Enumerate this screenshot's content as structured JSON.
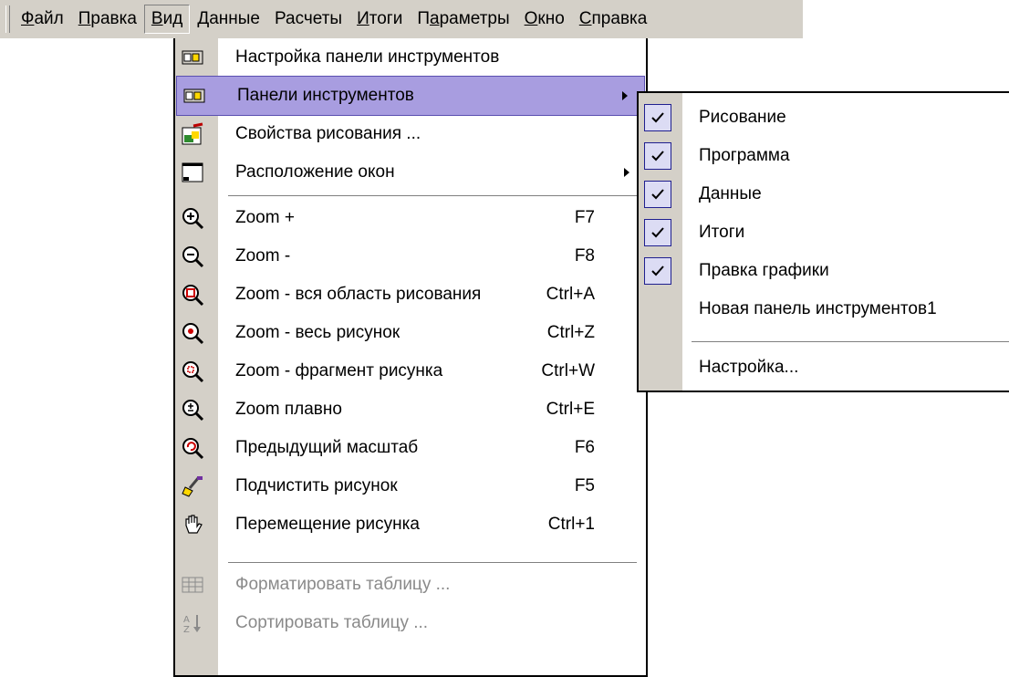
{
  "menubar": {
    "items": [
      {
        "label": "Файл",
        "accel": "Ф"
      },
      {
        "label": "Правка",
        "accel": "П"
      },
      {
        "label": "Вид",
        "accel": "В"
      },
      {
        "label": "Данные",
        "accel": "Д"
      },
      {
        "label": "Расчеты",
        "accel": ""
      },
      {
        "label": "Итоги",
        "accel": "И"
      },
      {
        "label": "Параметры",
        "accel": "а"
      },
      {
        "label": "Окно",
        "accel": "О"
      },
      {
        "label": "Справка",
        "accel": "С"
      }
    ],
    "open_item": "Вид"
  },
  "view_menu": {
    "items": [
      {
        "label": "Настройка панели инструментов",
        "shortcut": "",
        "icon": "toolbar-settings-icon"
      },
      {
        "label": "Панели инструментов",
        "shortcut": "",
        "icon": "toolbars-icon",
        "submenu": true,
        "highlighted": true
      },
      {
        "label": "Свойства рисования ...",
        "shortcut": "",
        "icon": "drawing-properties-icon"
      },
      {
        "label": "Расположение окон",
        "shortcut": "",
        "icon": "window-layout-icon",
        "submenu": true
      },
      {
        "label": "Zoom +",
        "shortcut": "F7",
        "icon": "zoom-in-icon"
      },
      {
        "label": "Zoom -",
        "shortcut": "F8",
        "icon": "zoom-out-icon"
      },
      {
        "label": "Zoom - вся область рисования",
        "shortcut": "Ctrl+A",
        "icon": "zoom-all-area-icon"
      },
      {
        "label": "Zoom - весь рисунок",
        "shortcut": "Ctrl+Z",
        "icon": "zoom-whole-picture-icon"
      },
      {
        "label": "Zoom - фрагмент рисунка",
        "shortcut": "Ctrl+W",
        "icon": "zoom-fragment-icon"
      },
      {
        "label": "Zoom плавно",
        "shortcut": "Ctrl+E",
        "icon": "zoom-smooth-icon"
      },
      {
        "label": "Предыдущий масштаб",
        "shortcut": "F6",
        "icon": "previous-zoom-icon"
      },
      {
        "label": "Подчистить рисунок",
        "shortcut": "F5",
        "icon": "clean-picture-icon"
      },
      {
        "label": "Перемещение рисунка",
        "shortcut": "Ctrl+1",
        "icon": "pan-hand-icon"
      },
      {
        "label": "Форматировать таблицу ...",
        "shortcut": "",
        "icon": "format-table-icon",
        "disabled": true
      },
      {
        "label": "Сортировать таблицу ...",
        "shortcut": "",
        "icon": "sort-table-icon",
        "disabled": true
      }
    ]
  },
  "toolbars_submenu": {
    "items": [
      {
        "label": "Рисование",
        "checked": true
      },
      {
        "label": "Программа",
        "checked": true
      },
      {
        "label": "Данные",
        "checked": true
      },
      {
        "label": "Итоги",
        "checked": true
      },
      {
        "label": "Правка графики",
        "checked": true
      },
      {
        "label": "Новая панель инструментов1",
        "checked": false
      },
      {
        "label": "Настройка...",
        "checked": false
      }
    ]
  },
  "colors": {
    "menubar_bg": "#d4d0c8",
    "highlight": "#a89de0",
    "disabled_text": "#8a8a8a"
  }
}
